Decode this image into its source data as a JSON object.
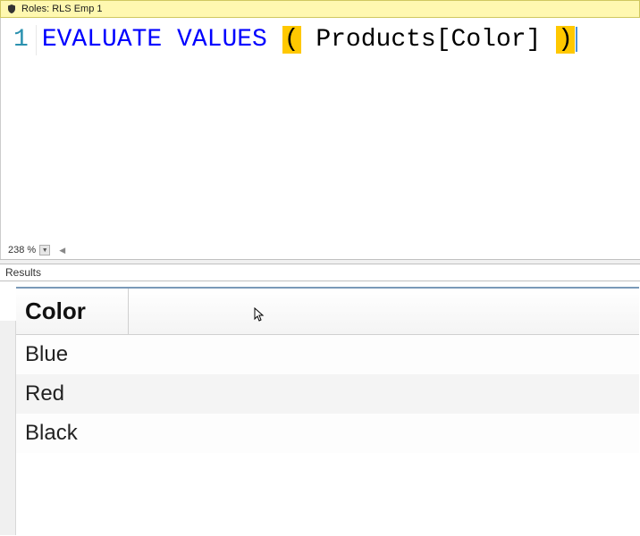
{
  "banner": {
    "label": "Roles: RLS Emp 1"
  },
  "editor": {
    "line_number": "1",
    "keyword1": "EVALUATE",
    "keyword2": "VALUES",
    "paren_open": "(",
    "paren_close": ")",
    "identifier": "Products[Color]"
  },
  "status": {
    "zoom": "238 %"
  },
  "results": {
    "header_label": "Results",
    "column": "Color",
    "rows": [
      "Blue",
      "Red",
      "Black"
    ]
  }
}
